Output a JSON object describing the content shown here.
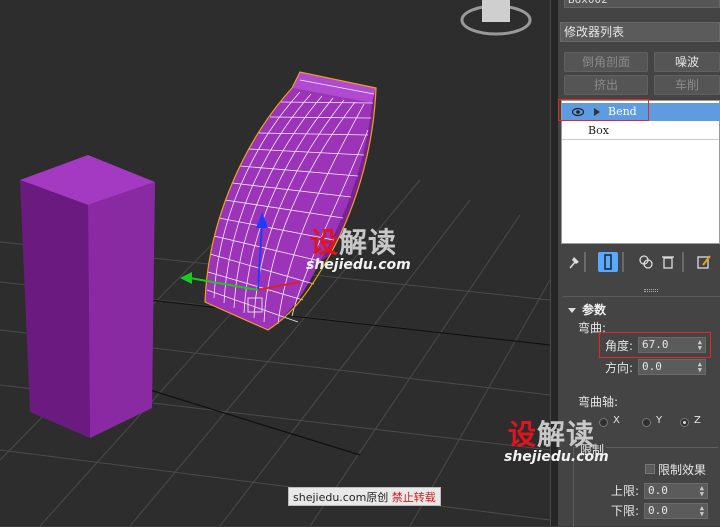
{
  "panel": {
    "object_name": "Box002",
    "modifier_list": "修改器列表",
    "buttons": {
      "chamfer": "倒角剖面",
      "noise": "噪波",
      "extrude": "挤出",
      "lathe": "车削"
    },
    "stack": {
      "items": [
        {
          "label": "Bend",
          "selected": true
        },
        {
          "label": "Box",
          "selected": false
        }
      ]
    },
    "tools": [
      "pin-stack",
      "show-end-result",
      "make-unique",
      "remove-modifier",
      "configure-sets"
    ],
    "rollout": {
      "title": "参数",
      "bend_group": "弯曲:",
      "angle_label": "角度:",
      "angle_value": "67.0",
      "direction_label": "方向:",
      "direction_value": "0.0",
      "axis_group": "弯曲轴:",
      "axes": [
        {
          "label": "X",
          "selected": false
        },
        {
          "label": "Y",
          "selected": false
        },
        {
          "label": "Z",
          "selected": true
        }
      ],
      "limits_group": "限制",
      "limit_effect_label": "限制效果",
      "upper_label": "上限:",
      "upper_value": "0.0",
      "lower_label": "下限:",
      "lower_value": "0.0"
    }
  },
  "watermark": {
    "logo_main": "设",
    "logo_rest": "解读",
    "url": "shejiedu.com",
    "footer_site": "shejiedu.com原创",
    "footer_warning": "禁止转载"
  },
  "colors": {
    "object_purple": "#8a2aa3",
    "selection_orange": "#f0a020",
    "highlight_red": "#e4272b",
    "stack_select_blue": "#5e9be0",
    "active_tool": "#5aa9ff"
  }
}
